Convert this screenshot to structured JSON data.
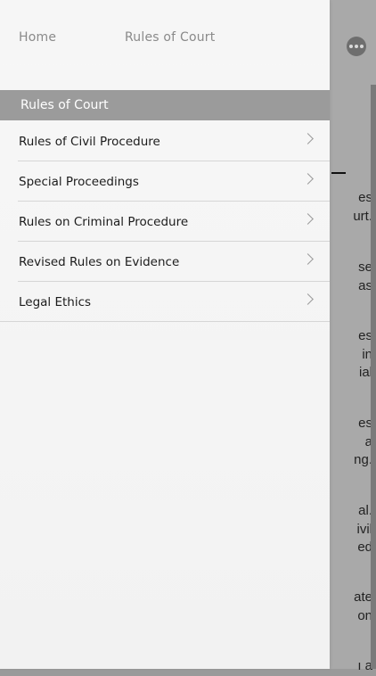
{
  "nav": {
    "home_label": "Home",
    "current_label": "Rules of Court"
  },
  "section": {
    "title": "Rules of Court"
  },
  "menu": {
    "items": [
      {
        "label": "Rules of Civil Procedure"
      },
      {
        "label": "Special Proceedings"
      },
      {
        "label": "Rules on Criminal Procedure"
      },
      {
        "label": "Revised Rules on Evidence"
      },
      {
        "label": "Legal Ethics"
      }
    ]
  },
  "background": {
    "more_icon": "more-horizontal-icon",
    "text_fragments": [
      "es\nurt.",
      "se\nas",
      "es\nin\nial",
      "es\na\nng.",
      "al.\nivil\ned",
      "ate\non",
      "ı a"
    ]
  },
  "colors": {
    "section_bar": "#9b9b9b",
    "drawer_bg": "#f6f6f6",
    "overlay_bg": "#a9a9a9"
  }
}
